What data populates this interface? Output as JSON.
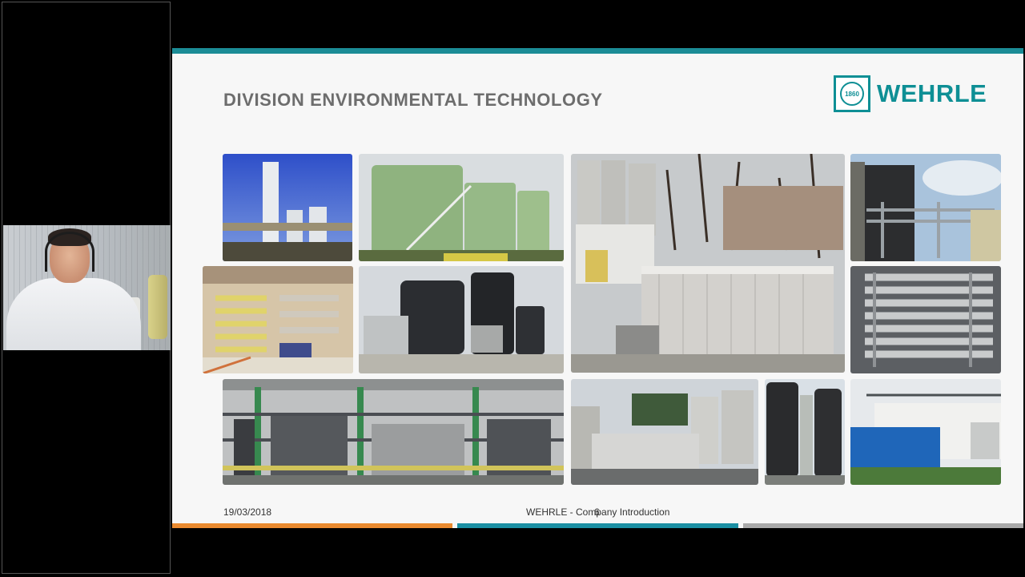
{
  "slide": {
    "title": "DIVISION ENVIRONMENTAL TECHNOLOGY",
    "logo_text": "WEHRLE",
    "logo_year": "1860",
    "footer_date": "19/03/2018",
    "footer_center": "WEHRLE - Company Introduction",
    "page_number": "6"
  },
  "colors": {
    "accent_teal": "#1b8c96",
    "logo_teal": "#0e8f95",
    "bar_orange": "#ea8a2f",
    "bar_gray": "#a9a9a9"
  },
  "photos": [
    "white-towers-photo",
    "green-tanks-photo",
    "container-plant-photo",
    "dark-tanks-photo",
    "pipe-hall-photo",
    "black-tanks-photo",
    "membrane-rack-photo",
    "steel-frame-plant-photo",
    "silver-silos-photo",
    "black-columns-photo",
    "blue-container-photo"
  ]
}
